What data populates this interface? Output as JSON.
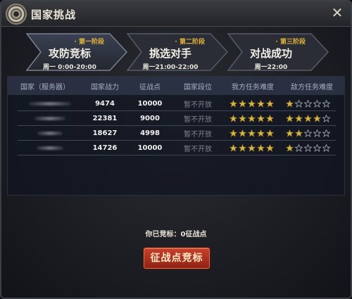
{
  "window": {
    "title": "国家挑战",
    "close_icon": "close-x-icon",
    "gear_icon": "gear-emblem-icon"
  },
  "stages": [
    {
      "phase": "第一阶段",
      "name": "攻防竞标",
      "time": "周一 0:00-20:00",
      "active": true
    },
    {
      "phase": "第二阶段",
      "name": "挑选对手",
      "time": "周一21:00-22:00",
      "active": false
    },
    {
      "phase": "第三阶段",
      "name": "对战成功",
      "time": "周一22:00",
      "active": false
    }
  ],
  "table": {
    "headers": [
      "国家（服务器）",
      "国家战力",
      "征战点",
      "国家段位",
      "我方任务难度",
      "敌方任务难度"
    ],
    "rows": [
      {
        "country": "",
        "power": "9474",
        "points": "10000",
        "rank": "暂不开放",
        "our_stars": 5,
        "enemy_stars": 1
      },
      {
        "country": "",
        "power": "22381",
        "points": "9000",
        "rank": "暂不开放",
        "our_stars": 5,
        "enemy_stars": 4
      },
      {
        "country": "",
        "power": "18627",
        "points": "4998",
        "rank": "暂不开放",
        "our_stars": 5,
        "enemy_stars": 2
      },
      {
        "country": "",
        "power": "14726",
        "points": "10000",
        "rank": "暂不开放",
        "our_stars": 5,
        "enemy_stars": 1
      }
    ],
    "max_stars": 5
  },
  "bid": {
    "status": "你已竞标：0征战点",
    "button_label": "征战点竞标"
  },
  "colors": {
    "accent_gold": "#e6b53a",
    "button_red": "#b8341f",
    "star_filled": "#d7b548",
    "star_empty": "#9aa0ab"
  }
}
